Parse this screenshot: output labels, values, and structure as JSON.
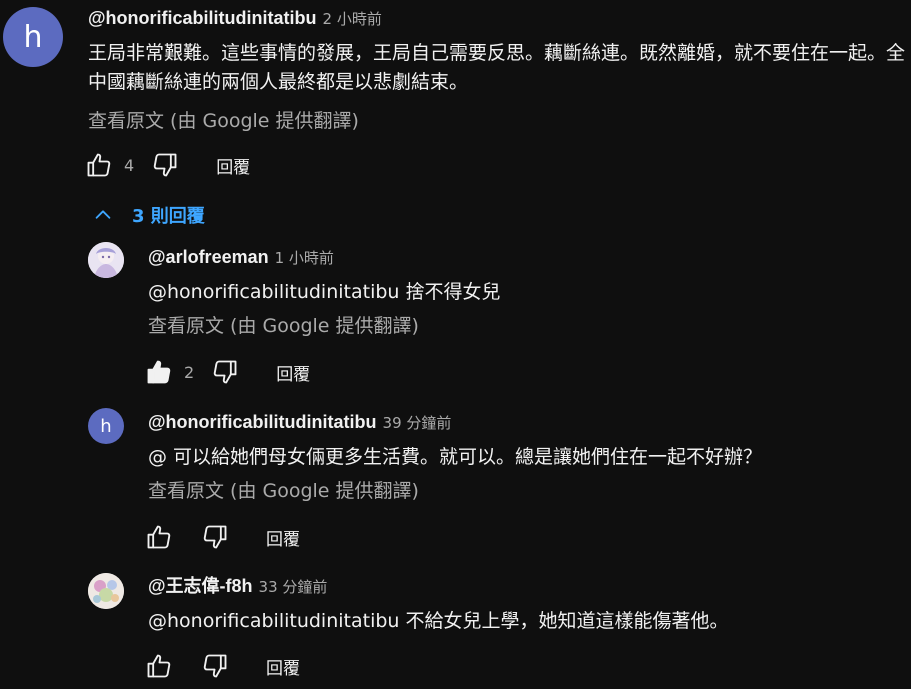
{
  "top_comment": {
    "avatar_letter": "h",
    "author": "@honorificabilitudinitatibu",
    "time": "2 小時前",
    "text": "王局非常艱難。這些事情的發展，王局自己需要反思。藕斷絲連。既然離婚，就不要住在一起。全中國藕斷絲連的兩個人最終都是以悲劇結束。",
    "translate": "查看原文 (由 Google 提供翻譯)",
    "likes": "4",
    "reply_label": "回覆"
  },
  "replies_toggle": {
    "label": "3 則回覆"
  },
  "replies": [
    {
      "author": "@arlofreeman",
      "time": "1 小時前",
      "text": "@honorificabilitudinitatibu 捨不得女兒",
      "translate": "查看原文 (由 Google 提供翻譯)",
      "likes": "2",
      "reply_label": "回覆"
    },
    {
      "avatar_letter": "h",
      "author": "@honorificabilitudinitatibu",
      "time": "39 分鐘前",
      "text": "@ 可以給她們母女倆更多生活費。就可以。總是讓她們住在一起不好辦？",
      "translate": "查看原文 (由 Google 提供翻譯)",
      "likes": "",
      "reply_label": "回覆"
    },
    {
      "author": "@王志偉-f8h",
      "time": "33 分鐘前",
      "text": "@honorificabilitudinitatibu 不給女兒上學，她知道這樣能傷著他。",
      "likes": "",
      "reply_label": "回覆"
    }
  ],
  "colors": {
    "background": "#0f0f0f",
    "text": "#f1f1f1",
    "secondary": "#aaaaaa",
    "link": "#3ea6ff",
    "avatar_letter_bg": "#5c6bc0"
  },
  "icons": [
    "thumb-up-icon",
    "thumb-down-icon",
    "chevron-up-icon"
  ]
}
